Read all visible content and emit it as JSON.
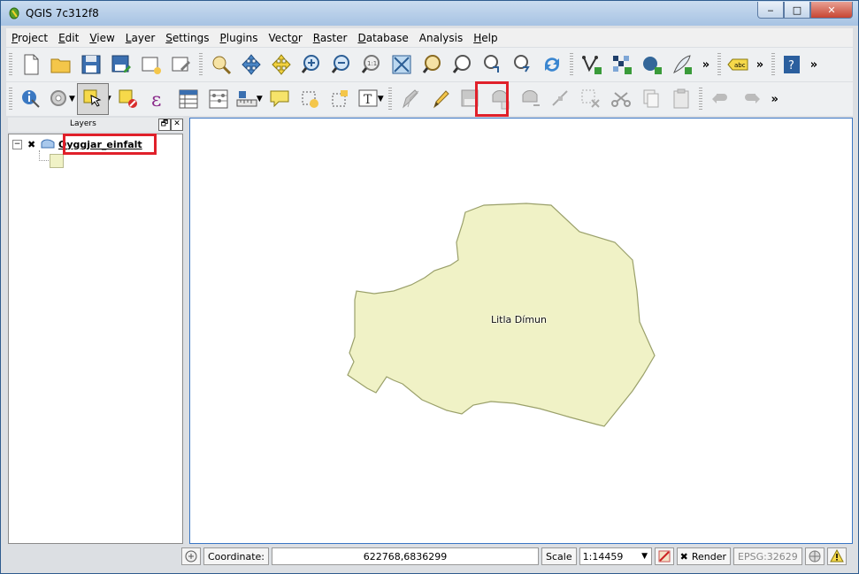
{
  "window": {
    "title": "QGIS 7c312f8",
    "controls": {
      "minimize": "‒",
      "maximize": "□",
      "close": "✕"
    }
  },
  "menubar": {
    "items": [
      {
        "label": "Project",
        "mnemonic": "P"
      },
      {
        "label": "Edit",
        "mnemonic": "E"
      },
      {
        "label": "View",
        "mnemonic": "V"
      },
      {
        "label": "Layer",
        "mnemonic": "L"
      },
      {
        "label": "Settings",
        "mnemonic": "S"
      },
      {
        "label": "Plugins",
        "mnemonic": "P"
      },
      {
        "label": "Vector",
        "mnemonic": "o"
      },
      {
        "label": "Raster",
        "mnemonic": "R"
      },
      {
        "label": "Database",
        "mnemonic": "D"
      },
      {
        "label": "Analysis",
        "mnemonic": ""
      },
      {
        "label": "Help",
        "mnemonic": "H"
      }
    ]
  },
  "toolbars": {
    "overflow": "»",
    "dropdown": "▼",
    "label_tool_text": "abc",
    "help_tool_text": "?",
    "text_annotation_text": "T",
    "expression_text": "ε"
  },
  "layers_panel": {
    "title": "Layers",
    "float_btn": "🗗",
    "close_btn": "✕",
    "layers": [
      {
        "name": "Oyggjar_einfalt",
        "visible": true,
        "expanded": true,
        "symbol_color": "#f0f2c6"
      }
    ],
    "collapse_glyph": "−",
    "check_glyph": "✖"
  },
  "map": {
    "feature_label": "Litla Dímun",
    "fill_color": "#f0f2c6",
    "stroke_color": "#9aa06a"
  },
  "statusbar": {
    "coordinate_label": "Coordinate:",
    "coordinate_value": "622768,6836299",
    "scale_label": "Scale",
    "scale_value": "1:14459",
    "render_label": "Render",
    "render_checked": "✖",
    "crs": "EPSG:32629"
  },
  "colors": {
    "highlight": "#e0202a",
    "accent": "#3a76c4"
  }
}
